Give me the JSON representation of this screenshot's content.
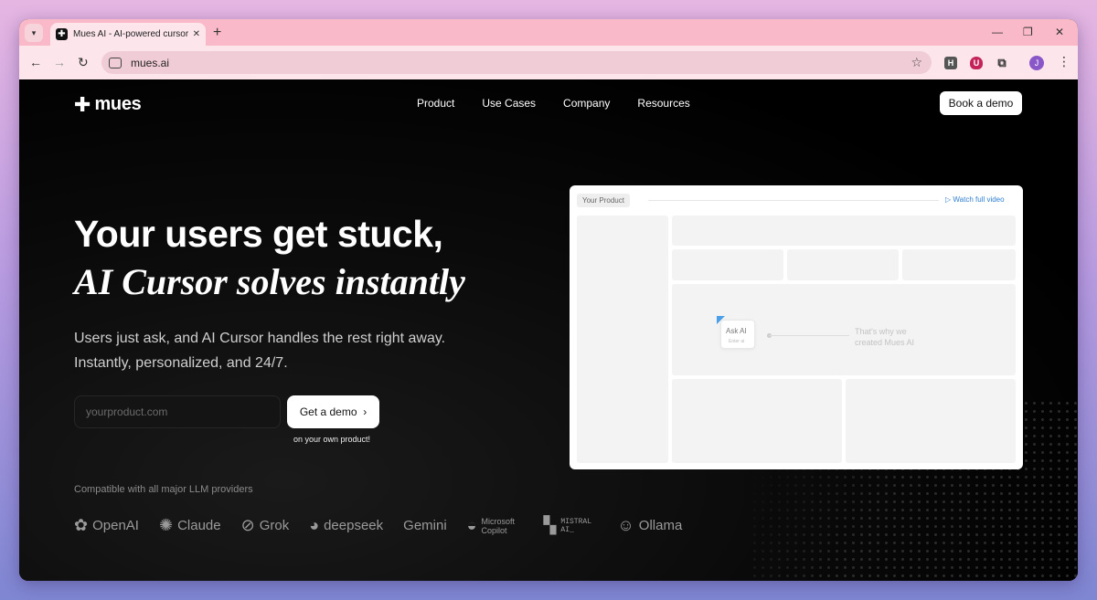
{
  "browser": {
    "tab_title": "Mues AI - AI-powered cursor fo",
    "tab_favicon": "✚",
    "url": "mues.ai",
    "extensions": [
      "H",
      "U"
    ],
    "profile_initial": "J"
  },
  "site": {
    "logo_text": "mues",
    "nav": [
      "Product",
      "Use Cases",
      "Company",
      "Resources"
    ],
    "book_demo_label": "Book a demo"
  },
  "hero": {
    "headline": "Your users get stuck,",
    "headline_italic": "AI Cursor solves instantly",
    "subtitle": "Users just ask, and AI Cursor handles the rest right away. Instantly, personalized, and 24/7.",
    "input_placeholder": "yourproduct.com",
    "cta_label": "Get a demo",
    "cta_chevron": "›",
    "cta_note": "on your own product!"
  },
  "compat": {
    "label": "Compatible with all major LLM providers",
    "providers": [
      {
        "name": "OpenAI",
        "icon": "openai-icon"
      },
      {
        "name": "Claude",
        "icon": "claude-icon"
      },
      {
        "name": "Grok",
        "icon": "grok-icon"
      },
      {
        "name": "deepseek",
        "icon": "deepseek-icon"
      },
      {
        "name": "Gemini",
        "icon": ""
      },
      {
        "name": "Microsoft Copilot",
        "icon": "copilot-icon"
      },
      {
        "name": "MISTRAL AI_",
        "icon": "mistral-icon"
      },
      {
        "name": "Ollama",
        "icon": "ollama-icon"
      }
    ]
  },
  "preview": {
    "tab_label": "Your Product",
    "watch_label": "Watch full video",
    "ask_label": "Ask AI",
    "ask_enter": "Enter ai",
    "why_text": "That's why we created Mues AI"
  },
  "colors": {
    "accent_blue": "#2f7fd0",
    "tab_strip": "#f9b9c8",
    "page_bg": "#000000"
  }
}
